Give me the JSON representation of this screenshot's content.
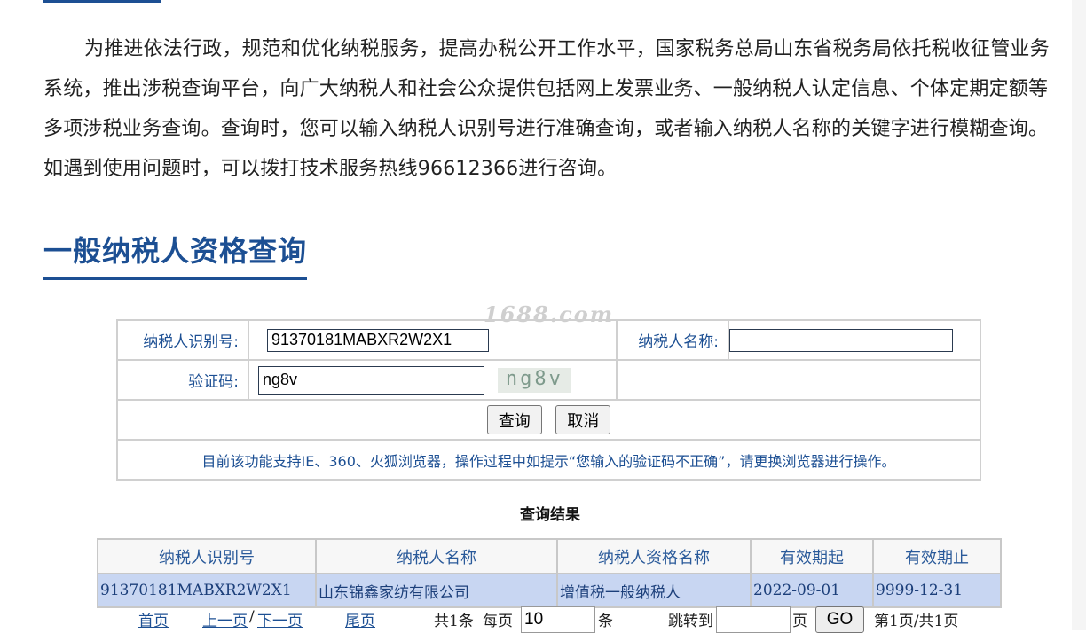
{
  "intro_text": "为推进依法行政，规范和优化纳税服务，提高办税公开工作水平，国家税务总局山东省税务局依托税收征管业务系统，推出涉税查询平台，向广大纳税人和社会公众提供包括网上发票业务、一般纳税人认定信息、个体定期定额等多项涉税业务查询。查询时，您可以输入纳税人识别号进行准确查询，或者输入纳税人名称的关键字进行模糊查询。如遇到使用问题时，可以拨打技术服务热线96612366进行咨询。",
  "section_title": "一般纳税人资格查询",
  "watermark": "1688.com",
  "form": {
    "taxpayer_id_label": "纳税人识别号:",
    "taxpayer_id_value": "91370181MABXR2W2X1",
    "taxpayer_name_label": "纳税人名称:",
    "taxpayer_name_value": "",
    "captcha_label": "验证码:",
    "captcha_value": "ng8v",
    "captcha_image_text": "ng8v",
    "search_button": "查询",
    "cancel_button": "取消",
    "notice": "目前该功能支持IE、360、火狐浏览器，操作过程中如提示“您输入的验证码不正确”，请更换浏览器进行操作。"
  },
  "results": {
    "title": "查询结果",
    "headers": [
      "纳税人识别号",
      "纳税人名称",
      "纳税人资格名称",
      "有效期起",
      "有效期止"
    ],
    "rows": [
      [
        "91370181MABXR2W2X1",
        "山东锦鑫家纺有限公司",
        "增值税一般纳税人",
        "2022-09-01",
        "9999-12-31"
      ]
    ]
  },
  "pager": {
    "first": "首页",
    "prev": "上一页",
    "sep": "/",
    "next": "下一页",
    "last": "尾页",
    "total": "共1条",
    "per_page_label": "每页",
    "per_page_value": "10",
    "per_page_unit": "条",
    "jump_label": "跳转到",
    "jump_value": "",
    "page_unit": "页",
    "go_button": "GO",
    "page_info": "第1页/共1页"
  },
  "colors": {
    "brand": "#1c4f93",
    "row_highlight": "#c8d6f2"
  }
}
